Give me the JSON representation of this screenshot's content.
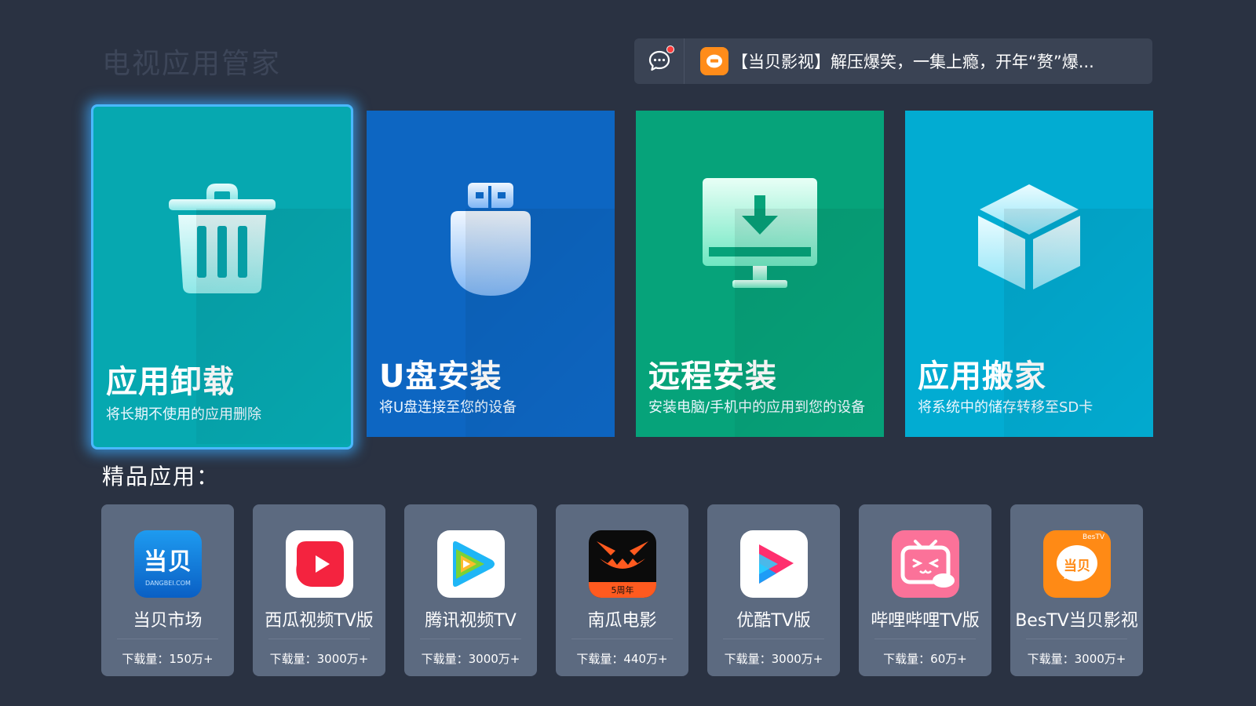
{
  "header": {
    "title": "电视应用管家",
    "notice": "【当贝影视】解压爆笑，一集上瘾，开年“赘”爆..."
  },
  "tiles": [
    {
      "title": "应用卸载",
      "subtitle": "将长期不使用的应用删除",
      "icon": "trash-icon",
      "color": "#06a8b0"
    },
    {
      "title": "U盘安装",
      "subtitle": "将U盘连接至您的设备",
      "icon": "usb-drive-icon",
      "color": "#0d66c2"
    },
    {
      "title": "远程安装",
      "subtitle": "安装电脑/手机中的应用到您的设备",
      "icon": "monitor-download-icon",
      "color": "#06a37a"
    },
    {
      "title": "应用搬家",
      "subtitle": "将系统中的储存转移至SD卡",
      "icon": "cube-icon",
      "color": "#02acd2"
    }
  ],
  "featured": {
    "title": "精品应用：",
    "apps": [
      {
        "name": "当贝市场",
        "downloads": "下载量：150万+",
        "icon": "dangbei-market-icon",
        "icon_text": "当贝",
        "icon_subtext": "DANGBEI.COM"
      },
      {
        "name": "西瓜视频TV版",
        "downloads": "下载量：3000万+",
        "icon": "xigua-video-icon"
      },
      {
        "name": "腾讯视频TV",
        "downloads": "下载量：3000万+",
        "icon": "tencent-video-icon"
      },
      {
        "name": "南瓜电影",
        "downloads": "下载量：440万+",
        "icon": "nangua-movie-icon",
        "icon_badge": "5周年"
      },
      {
        "name": "优酷TV版",
        "downloads": "下载量：3000万+",
        "icon": "youku-icon"
      },
      {
        "name": "哔哩哔哩TV版",
        "downloads": "下载量：60万+",
        "icon": "bilibili-icon"
      },
      {
        "name": "BesTV当贝影视",
        "downloads": "下载量：3000万+",
        "icon": "bestv-dangbei-icon",
        "icon_text": "当贝",
        "icon_badge": "BesTV"
      }
    ]
  },
  "colors": {
    "background": "#2a3242",
    "card": "#5c6a80",
    "focus": "#4ab8ff"
  }
}
